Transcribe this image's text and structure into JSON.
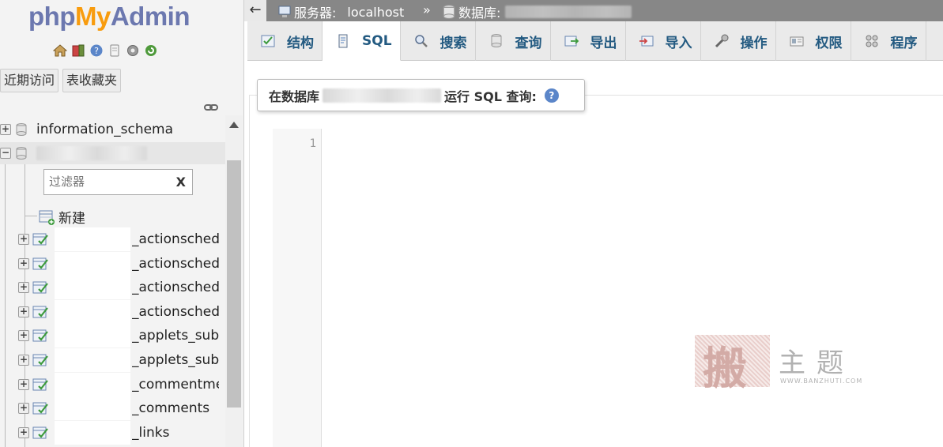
{
  "nav": {
    "logo": {
      "php": "php",
      "my": "My",
      "admin": "Admin"
    },
    "icons": [
      "home-icon",
      "logout-icon",
      "help-icon",
      "docs-icon",
      "settings-icon",
      "reload-icon"
    ],
    "tabs": [
      "近期访问",
      "表收藏夹"
    ],
    "databases": [
      {
        "name": "information_schema",
        "expanded": false
      }
    ],
    "filter": {
      "placeholder": "过滤器",
      "clear": "X"
    },
    "new_label": "新建",
    "tables": [
      "_actionsched",
      "_actionsched",
      "_actionsched",
      "_actionsched",
      "_applets_subs",
      "_applets_subs",
      "_commentme",
      "_comments",
      "_links"
    ]
  },
  "topbar": {
    "back": "←",
    "server_label": "服务器:",
    "server_value": "localhost",
    "separator": "»",
    "db_label": "数据库:",
    "db_value": ""
  },
  "tabs": [
    {
      "label": "结构",
      "icon": "structure-icon",
      "active": false
    },
    {
      "label": "SQL",
      "icon": "sql-icon",
      "active": true
    },
    {
      "label": "搜索",
      "icon": "search-icon",
      "active": false
    },
    {
      "label": "查询",
      "icon": "query-icon",
      "active": false
    },
    {
      "label": "导出",
      "icon": "export-icon",
      "active": false
    },
    {
      "label": "导入",
      "icon": "import-icon",
      "active": false
    },
    {
      "label": "操作",
      "icon": "operations-icon",
      "active": false
    },
    {
      "label": "权限",
      "icon": "privileges-icon",
      "active": false
    },
    {
      "label": "程序",
      "icon": "routines-icon",
      "active": false
    }
  ],
  "query": {
    "label_prefix": "在数据库",
    "label_suffix": "运行 SQL 查询:",
    "help": "?",
    "line_number": "1"
  },
  "watermark": {
    "mark": "搬",
    "text": "主题",
    "url": "WWW.BANZHUTI.COM"
  },
  "colors": {
    "tab_text": "#235a81",
    "topbar": "#878787",
    "logo_blue": "#6c78af",
    "logo_orange": "#f89c0e"
  }
}
